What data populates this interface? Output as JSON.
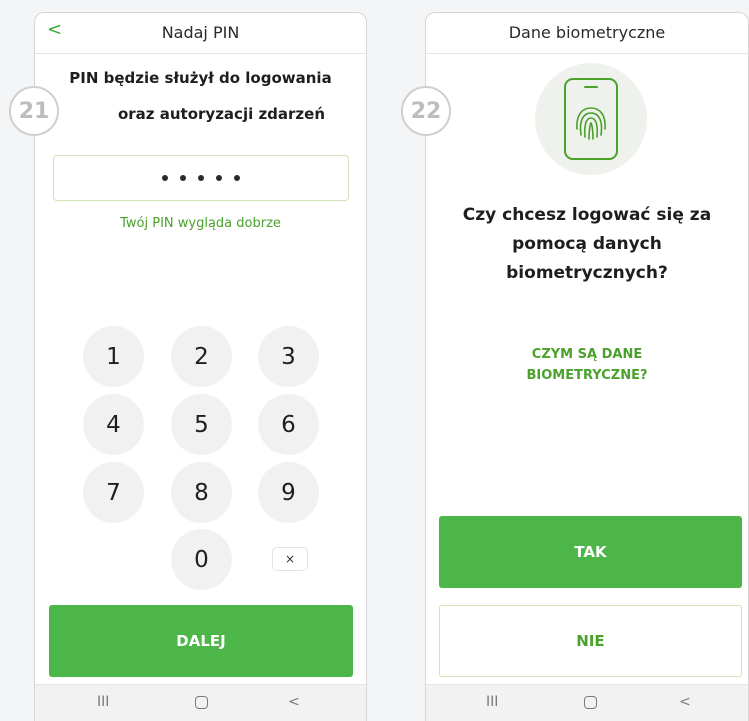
{
  "steps": [
    "21",
    "22"
  ],
  "screen_pin": {
    "title": "Nadaj PIN",
    "back_icon": "<",
    "heading_line1": "PIN będzie służył do logowania",
    "heading_line2": "oraz autoryzacji zdarzeń",
    "pin_length": 5,
    "pin_status": "Twój PIN wygląda dobrze",
    "keys": [
      "1",
      "2",
      "3",
      "4",
      "5",
      "6",
      "7",
      "8",
      "9",
      "0"
    ],
    "backspace_label": "×",
    "next_button": "DALEJ"
  },
  "screen_bio": {
    "title": "Dane biometryczne",
    "question_line1": "Czy chcesz logować się za",
    "question_line2": "pomocą danych",
    "question_line3": "biometrycznych?",
    "link_line1": "CZYM SĄ DANE",
    "link_line2": "BIOMETRYCZNE?",
    "yes_button": "TAK",
    "no_button": "NIE"
  },
  "nav": {
    "recent": "III",
    "back": "<"
  },
  "colors": {
    "accent": "#4db648",
    "accent_text": "#4aa12c",
    "background": "#f3f5f7"
  }
}
